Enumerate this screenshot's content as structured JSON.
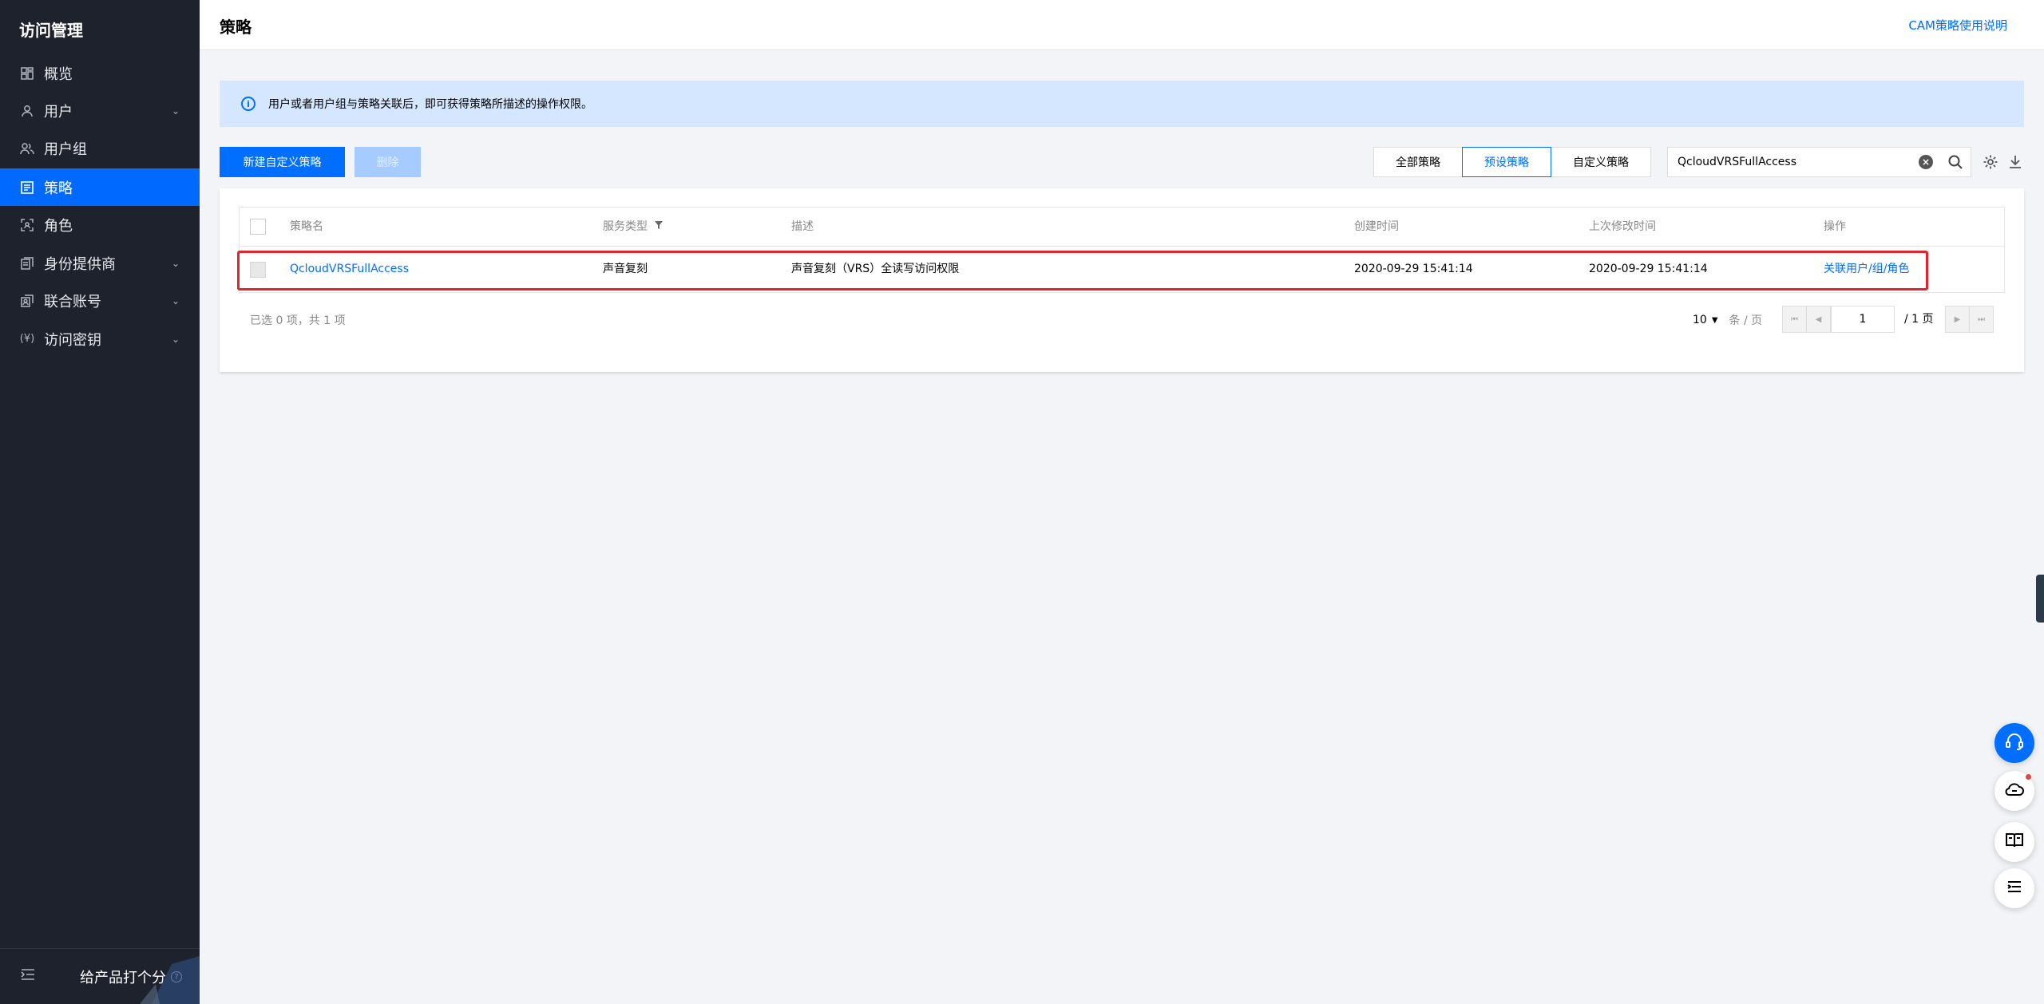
{
  "sidebar": {
    "title": "访问管理",
    "items": [
      {
        "label": "概览",
        "icon": "dashboard-icon",
        "has_children": false,
        "active": false
      },
      {
        "label": "用户",
        "icon": "user-icon",
        "has_children": true,
        "active": false
      },
      {
        "label": "用户组",
        "icon": "user-group-icon",
        "has_children": false,
        "active": false
      },
      {
        "label": "策略",
        "icon": "policy-icon",
        "has_children": false,
        "active": true
      },
      {
        "label": "角色",
        "icon": "role-icon",
        "has_children": false,
        "active": false
      },
      {
        "label": "身份提供商",
        "icon": "identity-provider-icon",
        "has_children": true,
        "active": false
      },
      {
        "label": "联合账号",
        "icon": "federated-account-icon",
        "has_children": true,
        "active": false
      },
      {
        "label": "访问密钥",
        "icon": "access-key-icon",
        "has_children": true,
        "active": false
      }
    ],
    "footer_rate_label": "给产品打个分"
  },
  "header": {
    "title": "策略",
    "doc_link": "CAM策略使用说明"
  },
  "notice": {
    "text": "用户或者用户组与策略关联后，即可获得策略所描述的操作权限。"
  },
  "toolbar": {
    "create_label": "新建自定义策略",
    "delete_label": "删除",
    "filters": [
      {
        "label": "全部策略",
        "active": false
      },
      {
        "label": "预设策略",
        "active": true
      },
      {
        "label": "自定义策略",
        "active": false
      }
    ],
    "search_value": "QcloudVRSFullAccess"
  },
  "table": {
    "columns": [
      "策略名",
      "服务类型",
      "描述",
      "创建时间",
      "上次修改时间",
      "操作"
    ],
    "rows": [
      {
        "name": "QcloudVRSFullAccess",
        "service": "声音复刻",
        "description": "声音复刻（VRS）全读写访问权限",
        "created": "2020-09-29 15:41:14",
        "modified": "2020-09-29 15:41:14",
        "action": "关联用户/组/角色"
      }
    ],
    "footer_info": "已选 0 项，共 1 项",
    "page_size": "10",
    "page_size_unit": "条 / 页",
    "current_page": "1",
    "total_pages": "/ 1 页"
  },
  "colors": {
    "primary": "#006eff",
    "sidebar_bg": "#1e222d",
    "highlight_border": "#e0262c"
  }
}
